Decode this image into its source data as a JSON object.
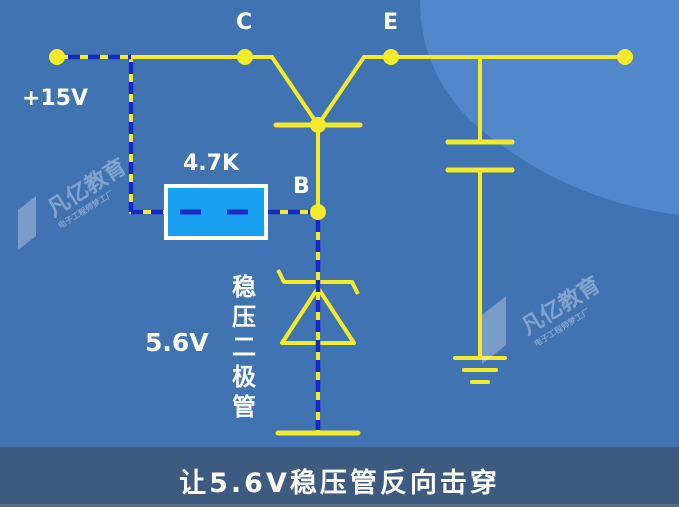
{
  "colors": {
    "background": "#3f73b1",
    "wire": "#f5ea2a",
    "current": "#1628c8",
    "resistor_fill": "#1aa0f0"
  },
  "labels": {
    "collector": "C",
    "emitter": "E",
    "base": "B",
    "supply": "+15V",
    "resistor": "4.7K",
    "zener_voltage": "5.6V",
    "zener_name": [
      "稳",
      "压",
      "二",
      "极",
      "管"
    ]
  },
  "watermark": {
    "brand": "凡亿教育",
    "tagline": "电子工程师梦工厂"
  },
  "subtitle": "让5.6V稳压管反向击穿",
  "progress": 0.0
}
